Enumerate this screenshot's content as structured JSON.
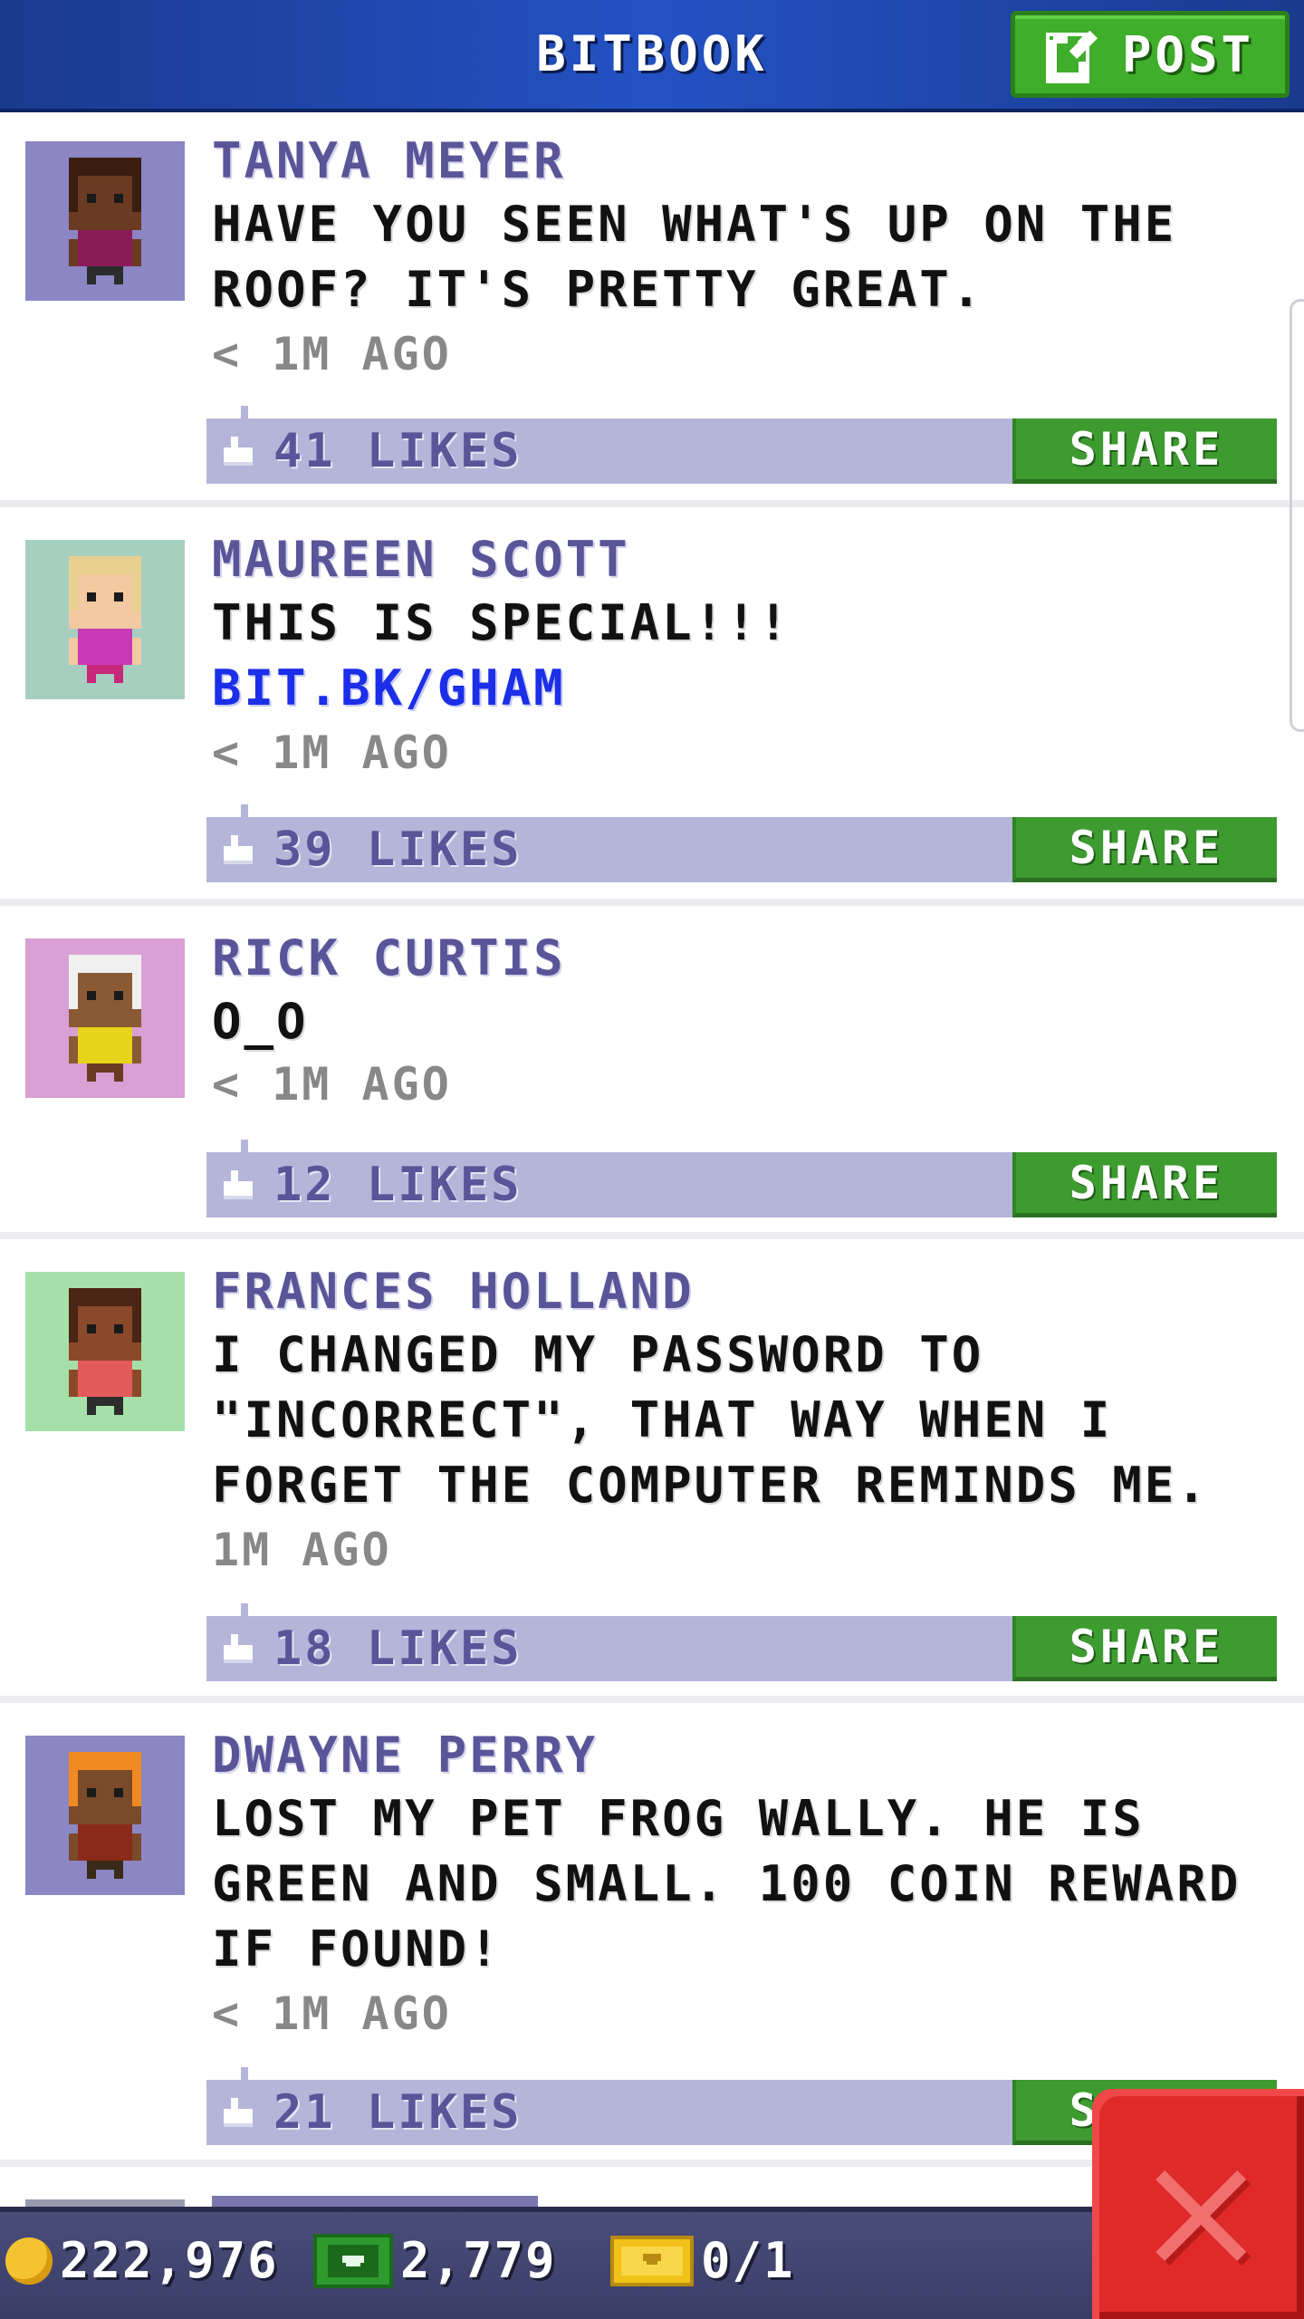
{
  "header": {
    "title": "BITBOOK",
    "post_label": "POST"
  },
  "posts": [
    {
      "author": "TANYA MEYER",
      "lines": [
        "HAVE YOU SEEN WHAT'S UP ON THE",
        "ROOF? IT'S PRETTY GREAT."
      ],
      "link": "",
      "time": "< 1M AGO",
      "likes": "41 LIKES",
      "share_label": "SHARE",
      "avatar_bg": "#8c86c4",
      "avatar": {
        "skin": "#6b3a22",
        "hair": "#3a1e10",
        "shirt": "#8a1a5a",
        "pants": "#2c2c2c"
      }
    },
    {
      "author": "MAUREEN SCOTT",
      "lines": [
        "THIS IS SPECIAL!!!"
      ],
      "link": "BIT.BK/GHAM",
      "time": "< 1M AGO",
      "likes": "39 LIKES",
      "share_label": "SHARE",
      "avatar_bg": "#a7cfc0",
      "avatar": {
        "skin": "#f2c9a0",
        "hair": "#e8d090",
        "shirt": "#c83ab8",
        "pants": "#c8287a"
      }
    },
    {
      "author": "RICK CURTIS",
      "lines": [
        "O_O"
      ],
      "link": "",
      "time": "< 1M AGO",
      "likes": "12 LIKES",
      "share_label": "SHARE",
      "avatar_bg": "#d8a0d4",
      "avatar": {
        "skin": "#8a5a34",
        "hair": "#f0f0f0",
        "shirt": "#e8d41a",
        "pants": "#6a3a22"
      }
    },
    {
      "author": "FRANCES HOLLAND",
      "lines": [
        "I CHANGED MY PASSWORD TO",
        "\"INCORRECT\", THAT WAY WHEN I",
        "FORGET THE COMPUTER REMINDS ME."
      ],
      "link": "",
      "time": "1M AGO",
      "likes": "18 LIKES",
      "share_label": "SHARE",
      "avatar_bg": "#a6e0a8",
      "avatar": {
        "skin": "#8a4a2a",
        "hair": "#4a2414",
        "shirt": "#e25a5a",
        "pants": "#2c2c2c"
      }
    },
    {
      "author": "DWAYNE PERRY",
      "lines": [
        "LOST MY PET FROG WALLY. HE IS",
        "GREEN AND SMALL. 100 COIN REWARD",
        "IF FOUND!"
      ],
      "link": "",
      "time": "< 1M AGO",
      "likes": "21 LIKES",
      "share_label": "SHARE",
      "avatar_bg": "#8c86c4",
      "avatar": {
        "skin": "#7a4a2a",
        "hair": "#f08a20",
        "shirt": "#8a2a1a",
        "pants": "#3a2a1a"
      }
    }
  ],
  "bottom_bar": {
    "coins": "222,976",
    "bux": "2,779",
    "tickets": "0/1"
  },
  "colors": {
    "header_blue": "#2452c4",
    "share_green": "#3d9b30",
    "likes_bar": "#b4b5d9",
    "author_purple": "#5a5498",
    "link_blue": "#1b2ee8",
    "close_red": "#e02a2a"
  }
}
